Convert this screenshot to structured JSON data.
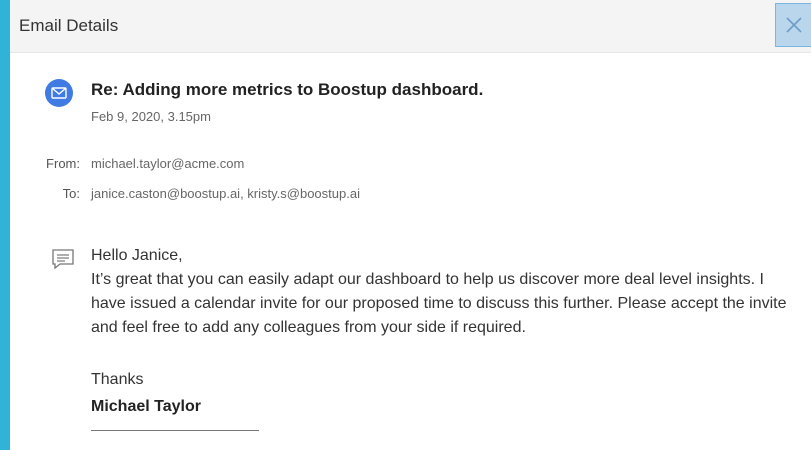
{
  "header": {
    "title": "Email Details",
    "close_icon": "close-icon"
  },
  "email": {
    "icon": "mail-icon",
    "subject": "Re: Adding more metrics to Boostup dashboard.",
    "date": "Feb 9, 2020,  3.15pm",
    "from_label": "From:",
    "from_value": "michael.taylor@acme.com",
    "to_label": "To:",
    "to_value": "janice.caston@boostup.ai, kristy.s@boostup.ai",
    "body_icon": "message-icon",
    "greeting": "Hello Janice,",
    "body": "It’s great that you can easily adapt our dashboard to help us discover more deal level insights. I have issued a calendar invite for our proposed time to discuss this further. Please accept the invite and feel free to add any colleagues from your side if required.",
    "closing": "Thanks",
    "signature": "Michael Taylor"
  },
  "colors": {
    "accent": "#3f7be2",
    "background": "#2fb3d6"
  }
}
